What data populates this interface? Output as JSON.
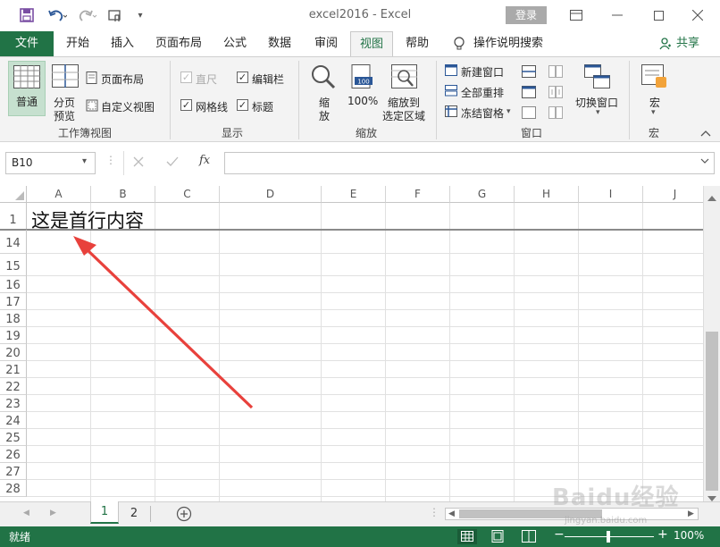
{
  "title_bar": {
    "title": "excel2016  -  Excel",
    "login_label": "登录",
    "save_icon": "save-icon",
    "undo_icon": "undo-icon",
    "redo_icon": "redo-icon"
  },
  "tabs": {
    "file": "文件",
    "items": [
      "开始",
      "插入",
      "页面布局",
      "公式",
      "数据",
      "审阅",
      "视图",
      "帮助"
    ],
    "tell_me": "操作说明搜索",
    "share": "共享"
  },
  "ribbon": {
    "workbook_views": {
      "normal": "普通",
      "page_break_line1": "分页",
      "page_break_line2": "预览",
      "page_layout": "页面布局",
      "custom_view": "自定义视图",
      "label": "工作簿视图"
    },
    "show": {
      "ruler": "直尺",
      "formula_bar": "编辑栏",
      "gridlines": "网格线",
      "headings": "标题",
      "label": "显示"
    },
    "zoom": {
      "zoom_line1": "缩",
      "zoom_line2": "放",
      "hundred": "100%",
      "zoom_sel_line1": "缩放到",
      "zoom_sel_line2": "选定区域",
      "label": "缩放",
      "icon_badge": "100"
    },
    "window": {
      "new_window": "新建窗口",
      "arrange_all": "全部重排",
      "freeze_panes": "冻结窗格",
      "switch_windows": "切换窗口",
      "label": "窗口"
    },
    "macros": {
      "macro": "宏",
      "label": "宏"
    }
  },
  "formula_bar": {
    "name_box": "B10",
    "fx": "fx"
  },
  "grid": {
    "columns": [
      "A",
      "B",
      "C",
      "D",
      "E",
      "F",
      "G",
      "H",
      "I",
      "J"
    ],
    "rows": [
      "1",
      "14",
      "15",
      "16",
      "17",
      "18",
      "19",
      "20",
      "21",
      "22",
      "23",
      "24",
      "25",
      "26",
      "27",
      "28"
    ],
    "cell_a1": "这是首行内容"
  },
  "sheets": {
    "tabs": [
      "1",
      "2"
    ],
    "active": "1"
  },
  "status": {
    "ready": "就绪",
    "zoom": "100%"
  },
  "colors": {
    "accent": "#217346",
    "arrow": "#e8413c"
  },
  "watermark": {
    "text": "Baidu经验",
    "url": "jingyan.baidu.com"
  }
}
